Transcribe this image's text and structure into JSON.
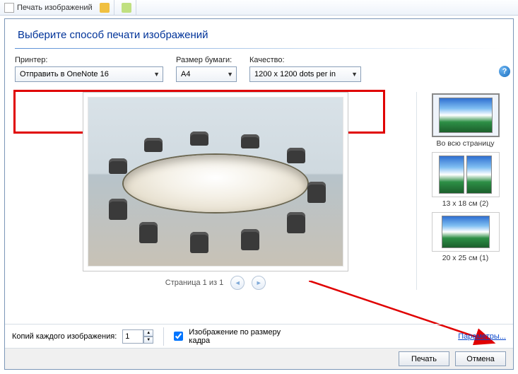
{
  "titlebar": {
    "title": "Печать изображений"
  },
  "header": {
    "title": "Выберите способ печати изображений"
  },
  "labels": {
    "printer": "Принтер:",
    "paper": "Размер бумаги:",
    "quality": "Качество:",
    "copies": "Копий каждого изображения:",
    "fit": "Изображение по размеру кадра",
    "options": "Параметры..."
  },
  "values": {
    "printer": "Отправить в OneNote 16",
    "paper": "A4",
    "quality": "1200 x 1200 dots per in",
    "copies": "1",
    "fit_checked": true
  },
  "pager": {
    "text": "Страница 1 из 1"
  },
  "layouts": [
    {
      "id": "full",
      "label": "Во всю страницу"
    },
    {
      "id": "half",
      "label": "13 x 18 см (2)"
    },
    {
      "id": "45",
      "label": "20 x 25 см (1)"
    }
  ],
  "buttons": {
    "print": "Печать",
    "cancel": "Отмена"
  },
  "help": "?"
}
